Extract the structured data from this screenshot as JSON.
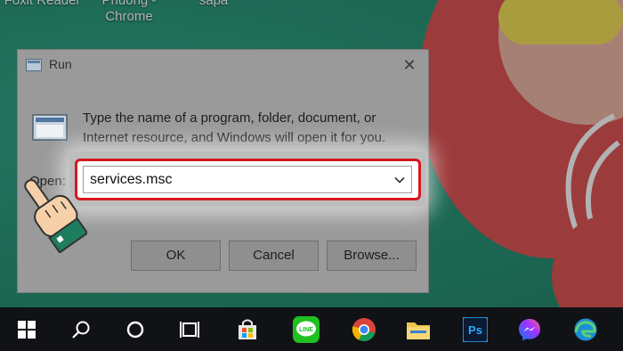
{
  "desktop": {
    "icons": [
      {
        "label_line1": "Foxit Reader",
        "label_line2": ""
      },
      {
        "label_line1": "Phuong -",
        "label_line2": "Chrome"
      },
      {
        "label_line1": "sapa",
        "label_line2": ""
      }
    ]
  },
  "run_dialog": {
    "title": "Run",
    "description": "Type the name of a program, folder, document, or Internet resource, and Windows will open it for you.",
    "open_label": "Open:",
    "open_value": "services.msc",
    "buttons": {
      "ok": "OK",
      "cancel": "Cancel",
      "browse": "Browse..."
    }
  },
  "taskbar": {
    "items": [
      "start-icon",
      "search-icon",
      "cortana-icon",
      "task-view-icon",
      "store-icon",
      "line-icon",
      "chrome-icon",
      "file-explorer-icon",
      "photoshop-icon",
      "messenger-icon",
      "edge-icon"
    ],
    "line_text": "LINE",
    "photoshop_text": "Ps"
  },
  "colors": {
    "highlight": "#d4181e",
    "wallpaper": "#2c9a7c",
    "taskbar": "#101216"
  }
}
